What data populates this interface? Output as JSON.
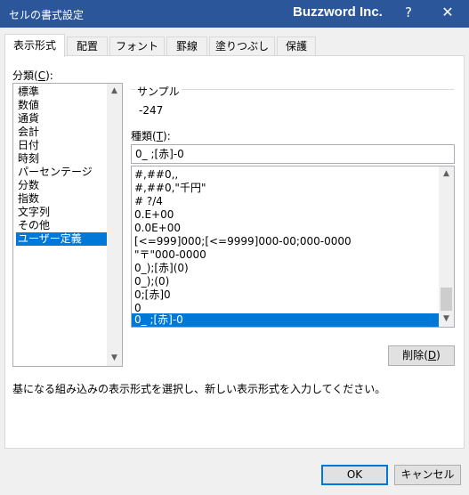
{
  "window": {
    "title": "セルの書式設定",
    "brand": "Buzzword Inc.",
    "help_label": "?",
    "close_label": "✕"
  },
  "tabs": [
    {
      "label": "表示形式",
      "active": true
    },
    {
      "label": "配置"
    },
    {
      "label": "フォント"
    },
    {
      "label": "罫線"
    },
    {
      "label": "塗りつぶし"
    },
    {
      "label": "保護"
    }
  ],
  "category": {
    "label": "分類",
    "accel": "C",
    "items": [
      "標準",
      "数値",
      "通貨",
      "会計",
      "日付",
      "時刻",
      "パーセンテージ",
      "分数",
      "指数",
      "文字列",
      "その他",
      "ユーザー定義"
    ],
    "selected": "ユーザー定義"
  },
  "sample": {
    "label": "サンプル",
    "value": "-247"
  },
  "type": {
    "label": "種類",
    "accel": "T",
    "value": "0_ ;[赤]-0",
    "items": [
      "#,##0,,",
      "#,##0,\"千円\"",
      "# ?/4",
      "0.E+00",
      "0.0E+00",
      "[<=999]000;[<=9999]000-00;000-0000",
      "\"〒\"000-0000",
      "0_);[赤](0)",
      "0_);(0)",
      "0;[赤]0",
      "0_",
      "0_ ;[赤]-0"
    ],
    "selected": "0_ ;[赤]-0"
  },
  "delete_button": {
    "label": "削除",
    "accel": "D"
  },
  "description": "基になる組み込みの表示形式を選択し、新しい表示形式を入力してください。",
  "ok_label": "OK",
  "cancel_label": "キャンセル",
  "colors": {
    "titlebar": "#2b579a",
    "selection": "#0078d7"
  }
}
